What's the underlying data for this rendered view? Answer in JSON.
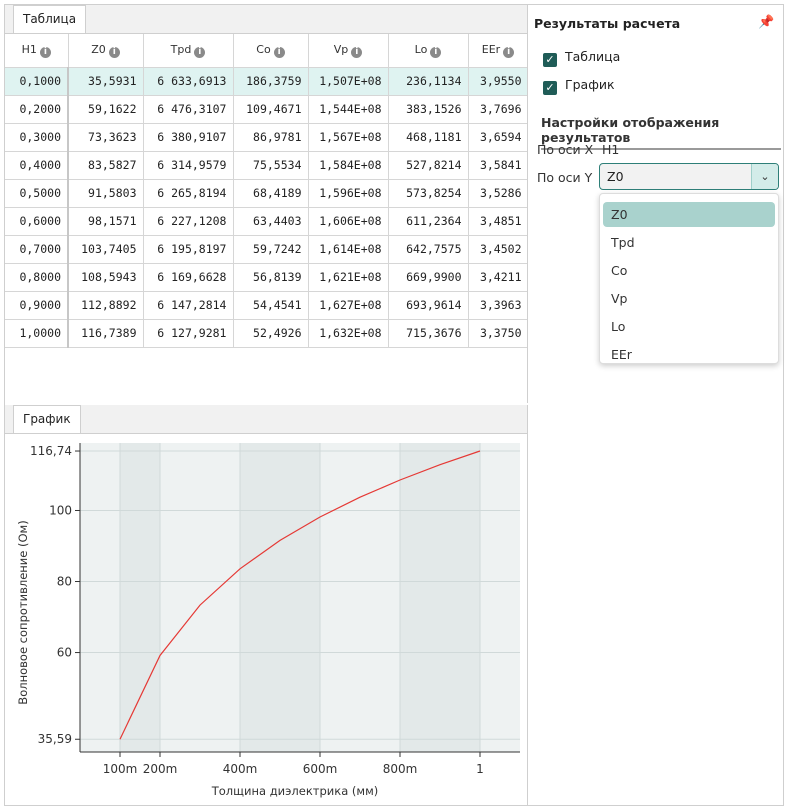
{
  "table_tab": "Таблица",
  "chart_tab": "График",
  "table": {
    "columns": [
      "H1",
      "Z0",
      "Tpd",
      "Co",
      "Vp",
      "Lo",
      "EEr"
    ],
    "selected_row": 0,
    "rows": [
      [
        "0,1000",
        "35,5931",
        "6 633,6913",
        "186,3759",
        "1,507E+08",
        "236,1134",
        "3,9550"
      ],
      [
        "0,2000",
        "59,1622",
        "6 476,3107",
        "109,4671",
        "1,544E+08",
        "383,1526",
        "3,7696"
      ],
      [
        "0,3000",
        "73,3623",
        "6 380,9107",
        "86,9781",
        "1,567E+08",
        "468,1181",
        "3,6594"
      ],
      [
        "0,4000",
        "83,5827",
        "6 314,9579",
        "75,5534",
        "1,584E+08",
        "527,8214",
        "3,5841"
      ],
      [
        "0,5000",
        "91,5803",
        "6 265,8194",
        "68,4189",
        "1,596E+08",
        "573,8254",
        "3,5286"
      ],
      [
        "0,6000",
        "98,1571",
        "6 227,1208",
        "63,4403",
        "1,606E+08",
        "611,2364",
        "3,4851"
      ],
      [
        "0,7000",
        "103,7405",
        "6 195,8197",
        "59,7242",
        "1,614E+08",
        "642,7575",
        "3,4502"
      ],
      [
        "0,8000",
        "108,5943",
        "6 169,6628",
        "56,8139",
        "1,621E+08",
        "669,9900",
        "3,4211"
      ],
      [
        "0,9000",
        "112,8892",
        "6 147,2814",
        "54,4541",
        "1,627E+08",
        "693,9614",
        "3,3963"
      ],
      [
        "1,0000",
        "116,7389",
        "6 127,9281",
        "52,4926",
        "1,632E+08",
        "715,3676",
        "3,3750"
      ]
    ]
  },
  "chart_data": {
    "type": "line",
    "xlabel": "Толщина диэлектрика (мм)",
    "ylabel": "Волновое сопротивление (Ом)",
    "xlim": [
      0.0,
      1.1
    ],
    "ylim": [
      32,
      119
    ],
    "x_ticks": [
      0.1,
      0.2,
      0.4,
      0.6,
      0.8,
      1.0
    ],
    "x_tick_labels": [
      "100m",
      "200m",
      "400m",
      "600m",
      "800m",
      "1"
    ],
    "y_ticks": [
      35.59,
      60,
      80,
      100,
      116.74
    ],
    "y_tick_labels": [
      "35,59",
      "60",
      "80",
      "100",
      "116,74"
    ],
    "grid": true,
    "line_color": "#e53935",
    "series": [
      {
        "x": [
          0.1,
          0.2,
          0.3,
          0.4,
          0.5,
          0.6,
          0.7,
          0.8,
          0.9,
          1.0
        ],
        "values": [
          35.5931,
          59.1622,
          73.3623,
          83.5827,
          91.5803,
          98.1571,
          103.7405,
          108.5943,
          112.8892,
          116.7389
        ]
      }
    ]
  },
  "right_panel": {
    "title": "Результаты расчета",
    "pin_icon": "pin-icon",
    "show_table_label": "Таблица",
    "show_chart_label": "График",
    "section_title": "Настройки отображения результатов",
    "x_axis_label": "По оси X",
    "x_axis_value": "H1",
    "y_axis_label": "По оси Y",
    "y_axis_selected": "Z0",
    "y_axis_options": [
      "Z0",
      "Tpd",
      "Co",
      "Vp",
      "Lo",
      "EEr"
    ]
  },
  "colors": {
    "accent": "#2e7f78",
    "selected_row": "#dff3f1",
    "checkbox": "#1f5c57"
  }
}
